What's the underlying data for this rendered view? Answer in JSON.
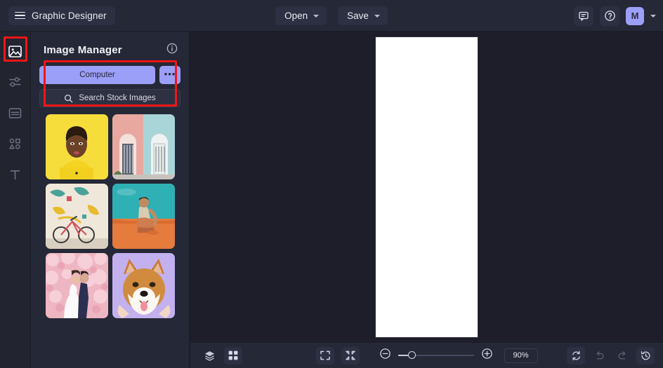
{
  "app": {
    "title": "Graphic Designer",
    "menu_icon": "hamburger-icon"
  },
  "topbar": {
    "open_label": "Open",
    "save_label": "Save",
    "comment_icon": "comment-icon",
    "help_icon": "help-circle-icon",
    "avatar_initial": "M",
    "avatar_color": "#9c9ff7"
  },
  "rail": {
    "items": [
      {
        "name": "image-manager",
        "icon": "image-icon",
        "active": true
      },
      {
        "name": "adjustments",
        "icon": "sliders-icon",
        "active": false
      },
      {
        "name": "templates",
        "icon": "layout-icon",
        "active": false
      },
      {
        "name": "elements",
        "icon": "shapes-icon",
        "active": false
      },
      {
        "name": "text",
        "icon": "text-icon",
        "active": false
      }
    ]
  },
  "panel": {
    "title": "Image Manager",
    "info_icon": "info-circle-icon",
    "computer_label": "Computer",
    "more_label": "•••",
    "search_placeholder": "Search Stock Images",
    "search_icon": "search-icon",
    "thumbnails": [
      {
        "name": "thumb-portrait-yellow",
        "alt": "woman in yellow shirt on yellow background"
      },
      {
        "name": "thumb-pastel-doors",
        "alt": "two pastel colored doors"
      },
      {
        "name": "thumb-bicycle-mural",
        "alt": "bicycle against painted mural wall"
      },
      {
        "name": "thumb-desert-man",
        "alt": "man sitting on orange desert sand"
      },
      {
        "name": "thumb-wedding-blossom",
        "alt": "couple kissing under cherry blossoms"
      },
      {
        "name": "thumb-shiba-dog",
        "alt": "shiba inu dog on purple background"
      }
    ]
  },
  "bottombar": {
    "layers_icon": "layers-icon",
    "grid_icon": "grid-icon",
    "fit_icon": "fit-screen-icon",
    "shrink_icon": "collapse-arrows-icon",
    "zoom_out_icon": "zoom-out-icon",
    "zoom_in_icon": "zoom-in-icon",
    "zoom_level": "90%",
    "reset_icon": "sync-icon",
    "undo_icon": "undo-icon",
    "redo_icon": "redo-icon",
    "history_icon": "history-icon"
  },
  "annotations": {
    "highlight_color": "#f31616",
    "boxes": [
      {
        "name": "rail-image-tool-highlight"
      },
      {
        "name": "upload-controls-highlight"
      }
    ]
  }
}
